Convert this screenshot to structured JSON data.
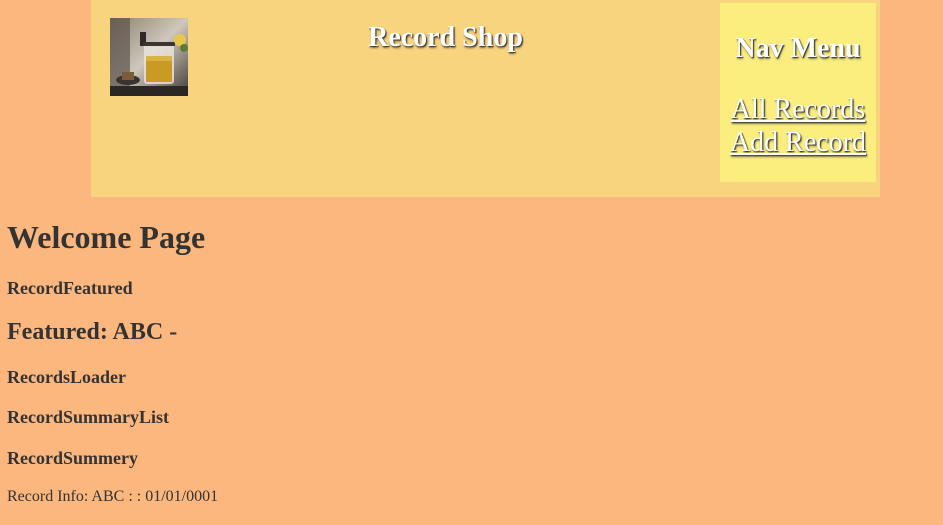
{
  "header": {
    "site_title": "Record Shop",
    "logo_icon": "french-press-tea-photo"
  },
  "nav": {
    "title": "Nav Menu",
    "links": [
      {
        "label": "All Records"
      },
      {
        "label": "Add Record"
      }
    ]
  },
  "main": {
    "page_title": "Welcome Page",
    "record_featured_label": "RecordFeatured",
    "featured_text": "Featured: ABC -",
    "records_loader_label": "RecordsLoader",
    "record_summary_list_label": "RecordSummaryList",
    "record_summery_label": "RecordSummery",
    "record_info_text": "Record Info: ABC : : 01/01/0001"
  },
  "colors": {
    "page_background": "#fbb77e",
    "header_background": "#f9d47f",
    "nav_background": "#fcee7e",
    "text": "#333333"
  }
}
